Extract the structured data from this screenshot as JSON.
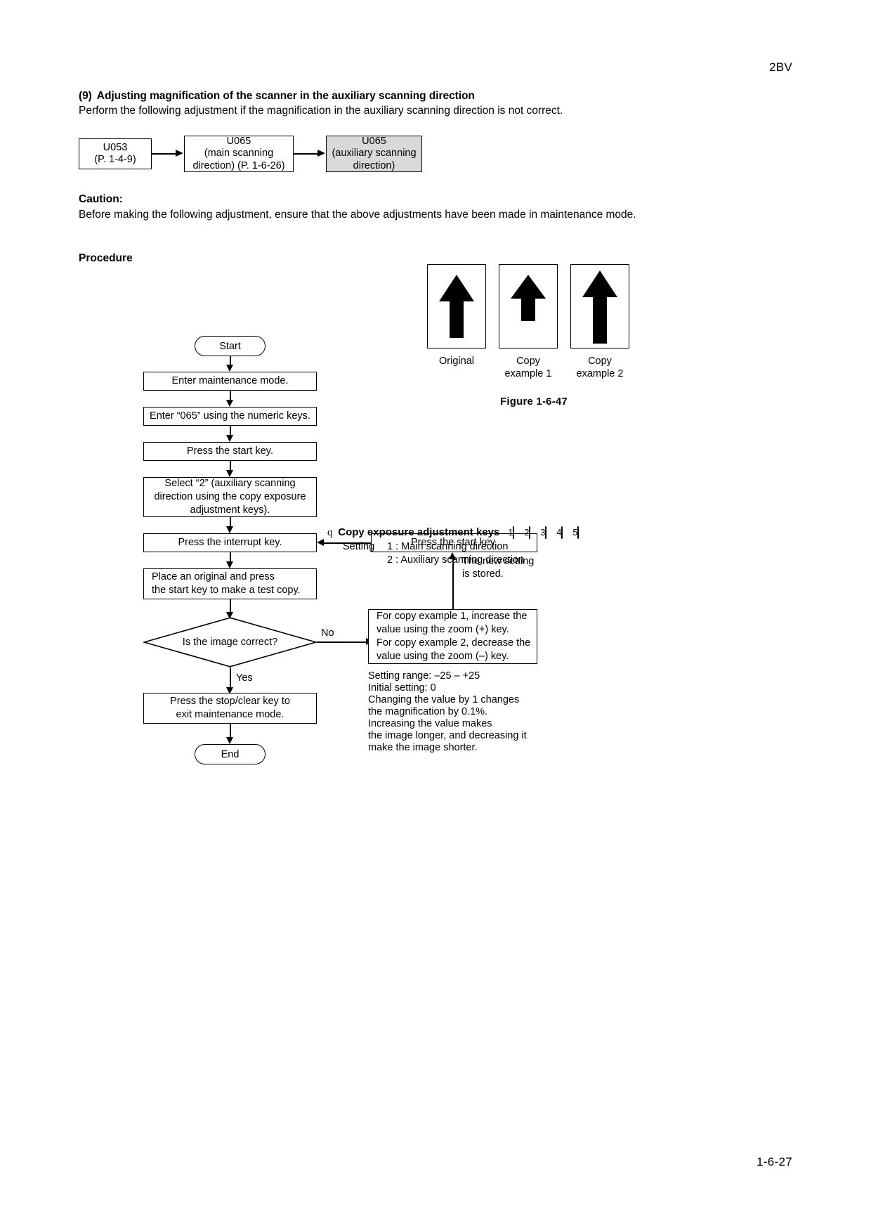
{
  "page": {
    "header_code": "2BV",
    "footer_page": "1-6-27"
  },
  "section": {
    "number": "(9)",
    "title": "Adjusting magnification of the scanner in the auxiliary scanning direction",
    "intro": "Perform the following adjustment if the magnification in the auxiliary scanning direction is not correct."
  },
  "mode_chain": {
    "boxes": [
      {
        "line1": "U053",
        "line2": "(P. 1-4-9)",
        "line3": "",
        "highlighted": false
      },
      {
        "line1": "U065",
        "line2": "(main scanning",
        "line3": "direction) (P. 1-6-26)",
        "highlighted": false
      },
      {
        "line1": "U065",
        "line2": "(auxiliary scanning",
        "line3": "direction)",
        "highlighted": true
      }
    ]
  },
  "caution": {
    "label": "Caution:",
    "text": "Before making the following adjustment, ensure that the above adjustments have been made in maintenance mode."
  },
  "procedure": {
    "label": "Procedure"
  },
  "figure": {
    "title": "Figure 1-6-47",
    "items": [
      {
        "caption_line1": "Original",
        "caption_line2": "",
        "arrow": "normal"
      },
      {
        "caption_line1": "Copy",
        "caption_line2": "example 1",
        "arrow": "short"
      },
      {
        "caption_line1": "Copy",
        "caption_line2": "example 2",
        "arrow": "long"
      }
    ]
  },
  "flowchart": {
    "start": "Start",
    "end": "End",
    "steps": {
      "enter_mode": "Enter maintenance mode.",
      "enter_065": "Enter “065” using the numeric keys.",
      "press_start_1": "Press the start key.",
      "select_2_l1": "Select “2” (auxiliary scanning",
      "select_2_l2": "direction using the copy exposure",
      "select_2_l3": "adjustment keys).",
      "press_interrupt": "Press the interrupt key.",
      "place_original_l1": "Place an original and press",
      "place_original_l2": "the start key to make a test copy.",
      "decision": "Is the image correct?",
      "press_stop_l1": "Press the stop/clear key to",
      "press_stop_l2": "exit maintenance mode.",
      "press_start_2": "Press the start key.",
      "adjust_l1": "For copy example 1, increase the",
      "adjust_l2": "value using the zoom (+) key.",
      "adjust_l3": "For copy example 2, decrease the",
      "adjust_l4": "value using the zoom (–) key."
    },
    "edge_labels": {
      "no": "No",
      "yes": "Yes"
    }
  },
  "callout": {
    "bullet": "q",
    "title": "Copy exposure adjustment keys",
    "setting_label": "Setting",
    "settings": [
      "1 : Main scanning direction",
      "2 : Auxiliary scanning direction"
    ],
    "keys": [
      {
        "num": "1",
        "active": true
      },
      {
        "num": "2",
        "active": true
      },
      {
        "num": "3",
        "active": false
      },
      {
        "num": "4",
        "active": false
      },
      {
        "num": "5",
        "active": false
      }
    ]
  },
  "notes": {
    "stored_l1": "The new setting",
    "stored_l2": "is stored.",
    "range": "Setting range: –25 – +25\nInitial setting: 0\nChanging the value by 1 changes\nthe magnification by 0.1%.\nIncreasing the value makes\nthe image longer, and decreasing it\nmake the image shorter."
  },
  "colors": {
    "highlight_fill": "#d9d9d9",
    "key_active_fill": "#bfbfbf",
    "line": "#000000"
  }
}
